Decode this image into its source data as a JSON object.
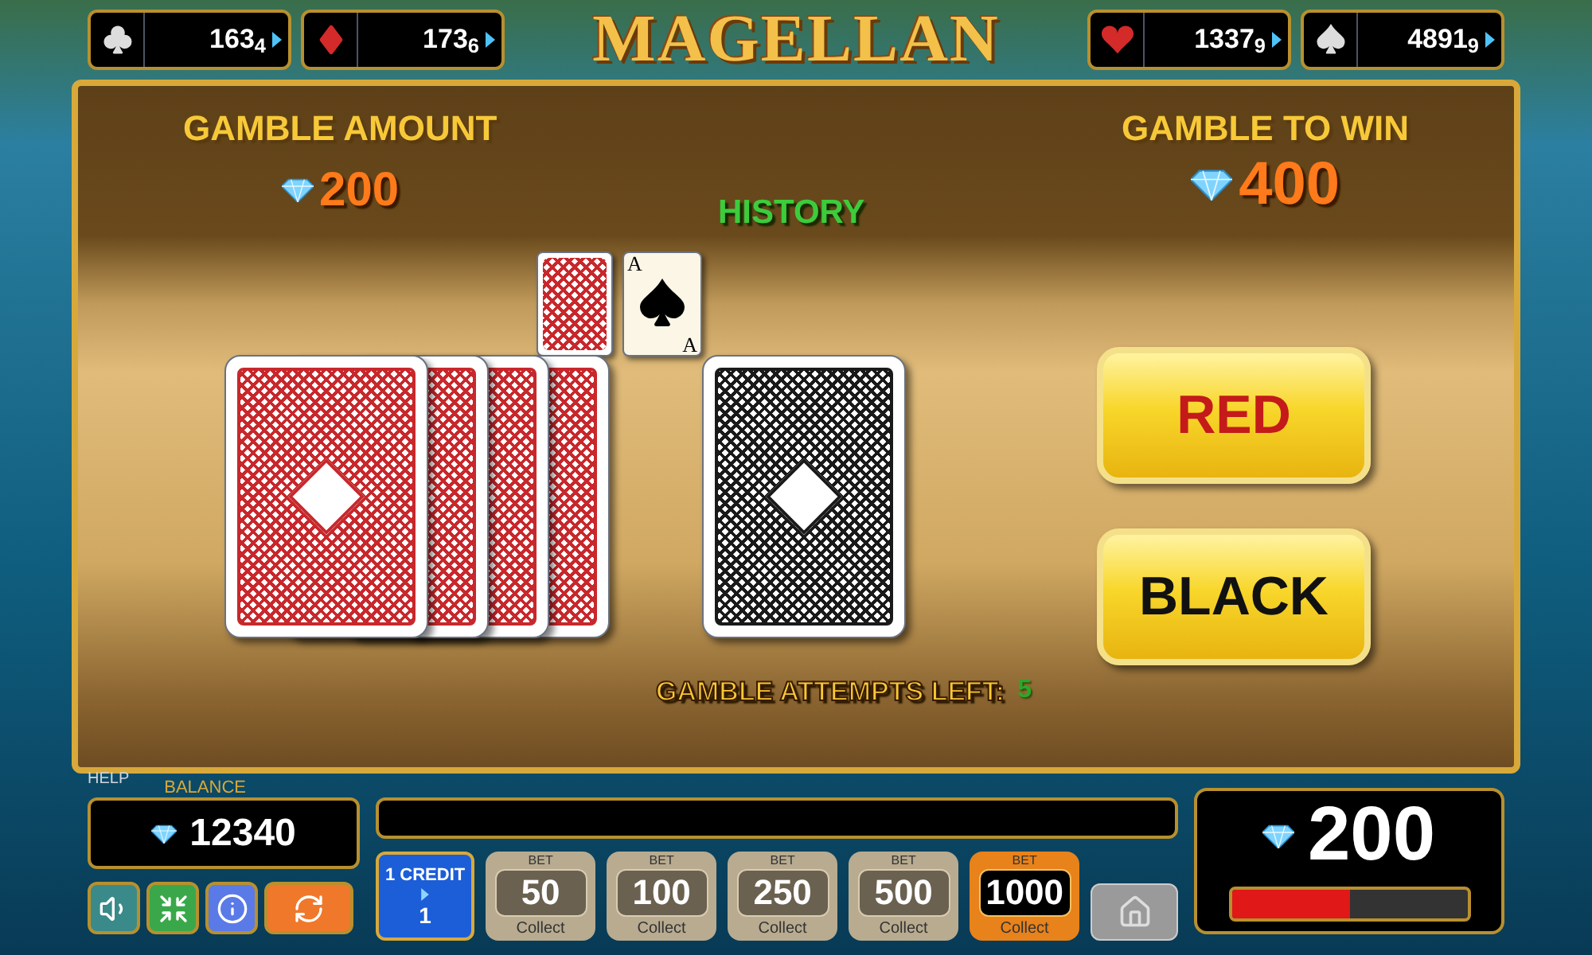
{
  "jackpots": [
    {
      "kind": "club",
      "value": "163$_{4}$"
    },
    {
      "kind": "diamond",
      "value": "173$_{6}$"
    },
    {
      "kind": "heart",
      "value": "1337$_{9}$"
    },
    {
      "kind": "spade",
      "value": "4891$_{9}$"
    }
  ],
  "logo": "MAGELLAN",
  "gamble_amount": {
    "label": "GAMBLE AMOUNT",
    "value": "200"
  },
  "gamble_to_win": {
    "label": "GAMBLE TO WIN",
    "value": "400"
  },
  "history": {
    "title": "HISTORY",
    "cards": [
      {
        "kind": "back"
      },
      {
        "kind": "face",
        "rank_top": "A",
        "rank_bottom": "A"
      }
    ]
  },
  "decks": [
    {
      "kind": "stack",
      "color": "#c8282c"
    },
    {
      "kind": "single",
      "color": "#1a1a1a"
    }
  ],
  "choice_buttons": [
    "RED",
    "BLACK"
  ],
  "attempts": {
    "label": "GAMBLE ATTEMPTS LEFT:",
    "value": "5"
  },
  "help": "HELP",
  "balance": {
    "label": "BALANCE",
    "value": "12340"
  },
  "credit": {
    "label": "1 CREDIT",
    "value": "1"
  },
  "bets": [
    {
      "label": "BET",
      "value": "50",
      "sub": "Collect",
      "selected": false
    },
    {
      "label": "BET",
      "value": "100",
      "sub": "Collect",
      "selected": false
    },
    {
      "label": "BET",
      "value": "250",
      "sub": "Collect",
      "selected": false
    },
    {
      "label": "BET",
      "value": "500",
      "sub": "Collect",
      "selected": false
    },
    {
      "label": "BET",
      "value": "1000",
      "sub": "Collect",
      "selected": true
    }
  ],
  "win": {
    "value": "200",
    "level": 0.5
  }
}
